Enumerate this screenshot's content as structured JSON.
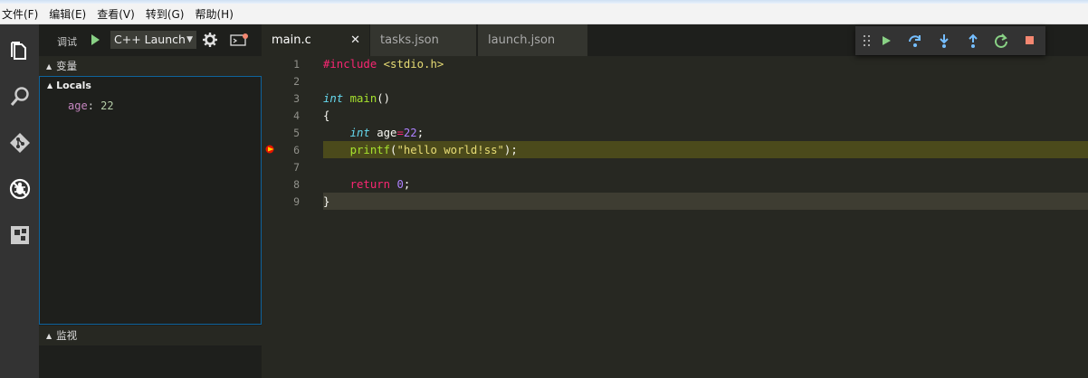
{
  "menubar": {
    "items": [
      "文件(F)",
      "编辑(E)",
      "查看(V)",
      "转到(G)",
      "帮助(H)"
    ]
  },
  "activity_bar": {
    "icons": [
      "explorer-icon",
      "search-icon",
      "git-icon",
      "debug-icon",
      "extensions-icon"
    ],
    "active": "debug-icon"
  },
  "debug_panel": {
    "title": "调试",
    "configuration": "C++ Launch",
    "sections": {
      "variables": {
        "title": "变量",
        "scope": "Locals",
        "vars": [
          {
            "name": "age",
            "value": "22"
          }
        ]
      },
      "watch": {
        "title": "监视"
      }
    }
  },
  "tabs": [
    {
      "label": "main.c",
      "active": true,
      "close": "✕"
    },
    {
      "label": "tasks.json",
      "active": false
    },
    {
      "label": "launch.json",
      "active": false
    }
  ],
  "debug_toolbar": {
    "buttons": [
      "drag-handle-icon",
      "continue-icon",
      "step-over-icon",
      "step-into-icon",
      "step-out-icon",
      "restart-icon",
      "stop-icon"
    ]
  },
  "editor": {
    "line_numbers": [
      "1",
      "2",
      "3",
      "4",
      "5",
      "6",
      "7",
      "8",
      "9"
    ],
    "stopped_line": 6,
    "cursor_line": 9,
    "lines": [
      "#include <stdio.h>",
      "",
      "int main()",
      "{",
      "    int age=22;",
      "    printf(\"hello world!ss\");",
      "",
      "    return 0;",
      "}"
    ]
  },
  "colors": {
    "accent": "#0e639c",
    "debug_start": "#89d185",
    "stop": "#f48771",
    "stopped_line": "#4b4a1b",
    "breakpoint": "#e51400",
    "breakpoint_arrow": "#ffcc00"
  }
}
